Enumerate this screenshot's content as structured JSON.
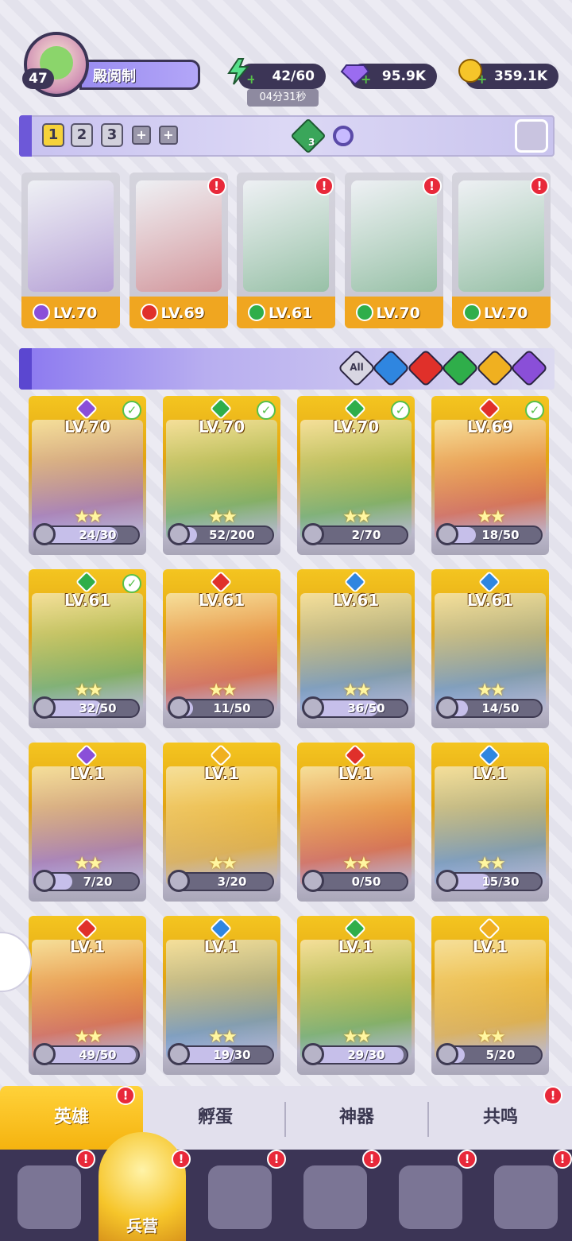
{
  "player": {
    "level": "47",
    "name": "殿阅制"
  },
  "resources": {
    "energy": "42/60",
    "energy_timer": "04分31秒",
    "gems": "95.9K",
    "gold": "359.1K"
  },
  "teams": {
    "tabs": [
      "1",
      "2",
      "3"
    ],
    "active": "1",
    "element_count": "3"
  },
  "lineup": [
    {
      "level": "LV.70",
      "element": "dark",
      "alert": false
    },
    {
      "level": "LV.69",
      "element": "fire",
      "alert": true
    },
    {
      "level": "LV.61",
      "element": "nature",
      "alert": true
    },
    {
      "level": "LV.70",
      "element": "nature",
      "alert": true
    },
    {
      "level": "LV.70",
      "element": "nature",
      "alert": true
    }
  ],
  "filters": {
    "all_label": "All",
    "elements": [
      "water",
      "fire",
      "nature",
      "light",
      "dark"
    ]
  },
  "heroes": [
    {
      "level": "LV.70",
      "element": "dark",
      "progress": "24/30",
      "ratio": 0.8,
      "selected": true
    },
    {
      "level": "LV.70",
      "element": "nature",
      "progress": "52/200",
      "ratio": 0.26,
      "selected": true
    },
    {
      "level": "LV.70",
      "element": "nature",
      "progress": "2/70",
      "ratio": 0.03,
      "selected": true
    },
    {
      "level": "LV.69",
      "element": "fire",
      "progress": "18/50",
      "ratio": 0.36,
      "selected": true
    },
    {
      "level": "LV.61",
      "element": "nature",
      "progress": "32/50",
      "ratio": 0.64,
      "selected": true
    },
    {
      "level": "LV.61",
      "element": "fire",
      "progress": "11/50",
      "ratio": 0.22,
      "selected": false
    },
    {
      "level": "LV.61",
      "element": "water",
      "progress": "36/50",
      "ratio": 0.72,
      "selected": false
    },
    {
      "level": "LV.61",
      "element": "water",
      "progress": "14/50",
      "ratio": 0.28,
      "selected": false
    },
    {
      "level": "LV.1",
      "element": "dark",
      "progress": "7/20",
      "ratio": 0.35,
      "selected": false
    },
    {
      "level": "LV.1",
      "element": "light",
      "progress": "3/20",
      "ratio": 0.15,
      "selected": false
    },
    {
      "level": "LV.1",
      "element": "fire",
      "progress": "0/50",
      "ratio": 0.0,
      "selected": false
    },
    {
      "level": "LV.1",
      "element": "water",
      "progress": "15/30",
      "ratio": 0.5,
      "selected": false
    },
    {
      "level": "LV.1",
      "element": "fire",
      "progress": "49/50",
      "ratio": 0.98,
      "selected": false
    },
    {
      "level": "LV.1",
      "element": "water",
      "progress": "19/30",
      "ratio": 0.63,
      "selected": false
    },
    {
      "level": "LV.1",
      "element": "nature",
      "progress": "29/30",
      "ratio": 0.97,
      "selected": false
    },
    {
      "level": "LV.1",
      "element": "light",
      "progress": "5/20",
      "ratio": 0.25,
      "selected": false
    }
  ],
  "tabs": [
    "英雄",
    "孵蛋",
    "神器",
    "共鸣"
  ],
  "nav": {
    "active_label": "兵营"
  },
  "colors": {
    "dark": "#8a4fd8",
    "fire": "#e0302a",
    "nature": "#2fae4a",
    "water": "#2f86e0",
    "light": "#f0b020",
    "accent": "#f5b30f"
  }
}
